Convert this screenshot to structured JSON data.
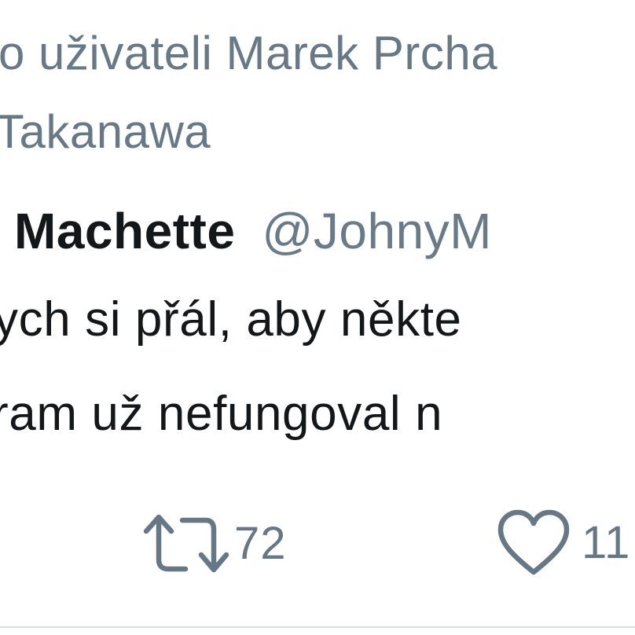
{
  "context": {
    "line1": "o uživateli Marek Prcha",
    "line2": "Takanawa"
  },
  "author": {
    "name": "Machette",
    "handle": "@JohnyM"
  },
  "tweet": {
    "line1": "ych si přál, aby někte",
    "line2": "ram už nefungoval n"
  },
  "actions": {
    "retweet": {
      "icon": "retweet-icon",
      "count": "72"
    },
    "like": {
      "icon": "heart-icon",
      "count": "11"
    }
  },
  "colors": {
    "text": "#14171a",
    "secondary": "#677886",
    "divider": "#d7dde2"
  }
}
